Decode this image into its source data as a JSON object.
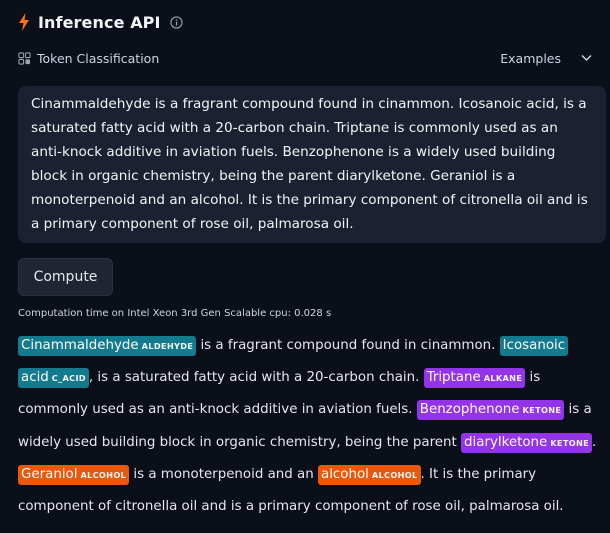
{
  "header": {
    "title": "Inference API",
    "bolt_color": "#f97316"
  },
  "subbar": {
    "task_label": "Token Classification",
    "examples_label": "Examples"
  },
  "textbox": {
    "value": "Cinammaldehyde is a fragrant compound found in cinammon. Icosanoic acid, is a saturated fatty acid with a 20-carbon chain. Triptane is commonly used as an anti-knock additive in aviation fuels. Benzophenone is a widely used building block in organic chemistry, being the parent diarylketone. Geraniol is a monoterpenoid and an alcohol. It is the primary component of citronella oil and is a primary component of rose oil, palmarosa oil."
  },
  "compute_button": {
    "label": "Compute"
  },
  "computation_time": "Computation time on Intel Xeon 3rd Gen Scalable cpu: 0.028 s",
  "entity_colors": {
    "ALDEHYDE": "#147b8f",
    "C_ACID": "#147b8f",
    "ALKANE": "#9333ea",
    "KETONE": "#9333ea",
    "ALCOHOL": "#ea580c"
  },
  "output": {
    "seg0_ent": "Cinammaldehyde",
    "seg0_lab": "ALDEHYDE",
    "seg1": " is a fragrant compound found in cinammon. ",
    "seg2_ent_a": "Icosanoic",
    "seg2_ent_b": "acid",
    "seg2_lab": "C_ACID",
    "seg3": ", is a saturated fatty acid with a 20-carbon chain. ",
    "seg4_ent": "Triptane",
    "seg4_lab": "ALKANE",
    "seg5": " is commonly used as an anti-knock additive in aviation fuels. ",
    "seg6_ent": "Benzophenone",
    "seg6_lab": "KETONE",
    "seg7": " is a widely used building block in organic chemistry, being the parent ",
    "seg8_ent": "diarylketone",
    "seg8_lab": "KETONE",
    "seg9": ". ",
    "seg10_ent": "Geraniol",
    "seg10_lab": "ALCOHOL",
    "seg11": " is a monoterpenoid and an ",
    "seg12_ent": "alcohol",
    "seg12_lab": "ALCOHOL",
    "seg13": ". It is the primary component of citronella oil and is a primary component of rose oil, palmarosa oil."
  }
}
